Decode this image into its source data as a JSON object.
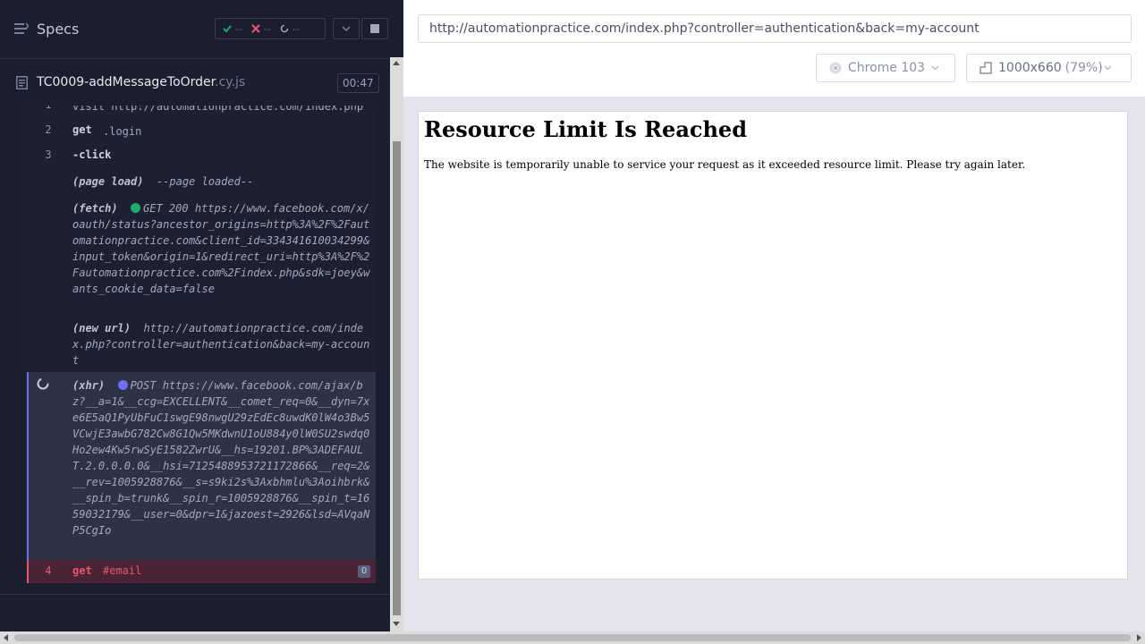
{
  "specs_bar": {
    "label": "Specs",
    "passed": "--",
    "failed": "--",
    "pending": "--"
  },
  "spec": {
    "name": "TC0009-addMessageToOrder",
    "ext": ".cy.js",
    "duration": "00:47"
  },
  "commands": {
    "visit_cut": "visit  http://automationpractice.com/index.php",
    "get_login": {
      "num": "2",
      "name": "get",
      "msg": ".login"
    },
    "click": {
      "num": "3",
      "name": "-click"
    },
    "page_load": {
      "name": "(page load)",
      "msg": "--page loaded--"
    },
    "fetch": {
      "name": "(fetch)",
      "status": "GET 200",
      "url": "https://www.facebook.com/x/oauth/status?ancestor_origins=http%3A%2F%2Fautomationpractice.com&client_id=334341610034299&input_token&origin=1&redirect_uri=http%3A%2F%2Fautomationpractice.com%2Findex.php&sdk=joey&wants_cookie_data=false"
    },
    "new_url": {
      "name": "(new url)",
      "url": "http://automationpractice.com/index.php?controller=authentication&back=my-account"
    },
    "xhr": {
      "name": "(xhr)",
      "method": "POST",
      "url": "https://www.facebook.com/ajax/bz?__a=1&__ccg=EXCELLENT&__comet_req=0&__dyn=7xe6E5aQ1PyUbFuC1swgE98nwgU29zEdEc8uwdK0lW4o3Bw5VCwjE3awbG782Cw8G1Qw5MKdwnU1oU884y0lW0SU2swdq0Ho2ew4Kw5rwSyE1582ZwrU&__hs=19201.BP%3ADEFAULT.2.0.0.0.0&__hsi=7125488953721172866&__req=2&__rev=1005928876&__s=s9ki2s%3Axbhmlu%3Aoihbrk&__spin_b=trunk&__spin_r=1005928876&__spin_t=1659032179&__user=0&dpr=1&jazoest=2926&lsd=AVqaNP5CgIo"
    },
    "get_email": {
      "num": "4",
      "name": "get",
      "msg": "#email",
      "badge": "0"
    }
  },
  "aut": {
    "url": "http://automationpractice.com/index.php?controller=authentication&back=my-account",
    "browser": "Chrome 103",
    "viewport": "1000x660",
    "scale": "(79%)",
    "page_title": "Resource Limit Is Reached",
    "page_text": "The website is temporarily unable to service your request as it exceeded resource limit. Please try again later."
  },
  "colors": {
    "reporter_bg": "#1b1e2e",
    "pass": "#1fa971",
    "fail": "#e45770",
    "xhr_dot": "#6b6ff0",
    "fetch_dot": "#1fa971"
  },
  "icons": [
    "menu-icon",
    "check-icon",
    "x-icon",
    "spinner-icon",
    "chevron-down-icon",
    "stop-icon",
    "file-icon",
    "chrome-icon",
    "viewport-icon"
  ]
}
